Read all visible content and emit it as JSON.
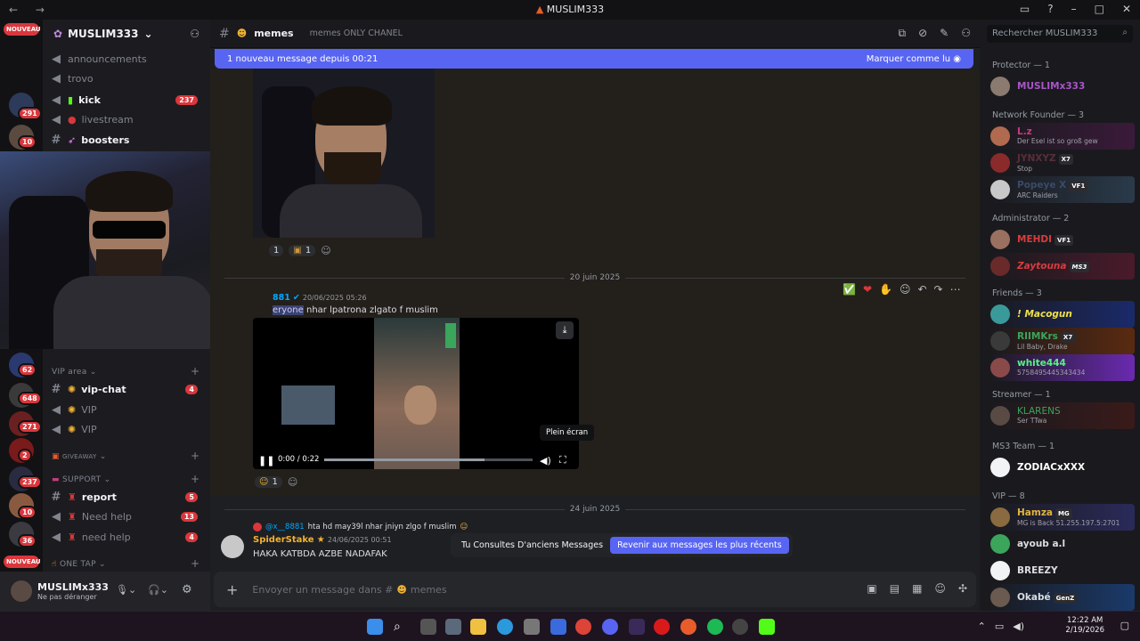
{
  "window": {
    "title": "MUSLIM333",
    "nav": "← →"
  },
  "server": {
    "name": "MUSLIM333",
    "badges": {
      "s1": "291",
      "s2": "10",
      "s3": "62",
      "s4": "648",
      "s5": "271",
      "s6": "2",
      "s7": "237",
      "s8": "10",
      "s9": "36"
    },
    "nouveau_label": "NOUVEAU"
  },
  "channels": {
    "top": [
      {
        "name": "announcements"
      },
      {
        "name": "trovo"
      },
      {
        "name": "kick",
        "badge": "237"
      },
      {
        "name": "livestream"
      },
      {
        "name": "boosters"
      }
    ],
    "cat_vip": "VIP area",
    "vip": [
      {
        "name": "vip-chat",
        "badge": "4"
      },
      {
        "name": "VIP"
      },
      {
        "name": "VIP"
      }
    ],
    "cat_giveaway": "GIVEAWAY",
    "cat_support": "SUPPORT",
    "support": [
      {
        "name": "report",
        "badge": "5"
      },
      {
        "name": "Need help",
        "badge": "13"
      },
      {
        "name": "need help",
        "badge": "4"
      }
    ],
    "cat_onetap": "ONE TAP"
  },
  "user": {
    "name": "MUSLIMx333",
    "status": "Ne pas déranger"
  },
  "header": {
    "channel": "memes",
    "topic": "memes ONLY CHANEL",
    "search_placeholder": "Rechercher MUSLIM333"
  },
  "banner": {
    "text": "1 nouveau message depuis 00:21",
    "action": "Marquer comme lu"
  },
  "messages": {
    "day1": "20 juin 2025",
    "m1_author": "881",
    "m1_time": "20/06/2025 05:26",
    "m1_mention": "eryone",
    "m1_text": "nhar lpatrona zlgato f muslim",
    "video_time": "0:00 / 0:22",
    "tooltip": "Plein écran",
    "r1_count": "1",
    "r2_count": "1",
    "r3_count": "1",
    "day2": "24 juin 2025",
    "reply_ref": "@x__8881",
    "reply_text": "hta hd may39l nhar jniyn zlgo f muslim",
    "m2_author": "SpiderStake",
    "m2_time": "24/06/2025 00:51",
    "m2_text": "HAKA KATBDA AZBE NADAFAK",
    "old_notice": "Tu Consultes D'anciens Messages",
    "old_button": "Revenir aux messages les plus récents"
  },
  "composer": {
    "placeholder": "Envoyer un message dans #",
    "channel": "memes"
  },
  "members": [
    {
      "cat": "Protector — 1"
    },
    {
      "name": "MUSLIMx333",
      "color": "#a855c7"
    },
    {
      "cat": "Network Founder — 3"
    },
    {
      "name": "L.z",
      "sub": "Der Esel ist so groß gew",
      "color": "#c43c7c"
    },
    {
      "name": "JYNXYZ",
      "tag": "X7",
      "sub": "Stop",
      "color": "#5a2d3a"
    },
    {
      "name": "Popeye X",
      "tag": "VF1",
      "sub": "ARC Raiders",
      "color": "#3b4a6a"
    },
    {
      "cat": "Administrator — 2"
    },
    {
      "name": "MEHDI",
      "tag": "VF1",
      "color": "#d83c3e"
    },
    {
      "name": "Zaytouna",
      "tag": "MS3",
      "color": "#d83c3e"
    },
    {
      "cat": "Friends — 3"
    },
    {
      "name": "! Macogun",
      "color": "#f0e04a"
    },
    {
      "name": "RIIMKrs",
      "tag": "X7",
      "sub": "Lil Baby, Drake",
      "color": "#3ba55c"
    },
    {
      "name": "white444",
      "sub": "5758495445343434",
      "color": "#57f287"
    },
    {
      "cat": "Streamer — 1"
    },
    {
      "name": "KLARENS",
      "sub": "Ser TTwa",
      "color": "#3ba55c"
    },
    {
      "cat": "MS3 Team — 1"
    },
    {
      "name": "ZODIACxXXX",
      "color": "#ffffff"
    },
    {
      "cat": "VIP — 8"
    },
    {
      "name": "Hamza",
      "tag": "MG",
      "sub": "MG is Back 51.255.197.5:2701",
      "color": "#e0b43c"
    },
    {
      "name": "ayoub a.l",
      "color": "#dbdee1"
    },
    {
      "name": "BREEZY",
      "color": "#dbdee1"
    },
    {
      "name": "Okabé",
      "tag": "GenZ",
      "color": "#dbdee1"
    }
  ],
  "clock": {
    "time": "12:22 AM",
    "date": "2/19/2026"
  }
}
